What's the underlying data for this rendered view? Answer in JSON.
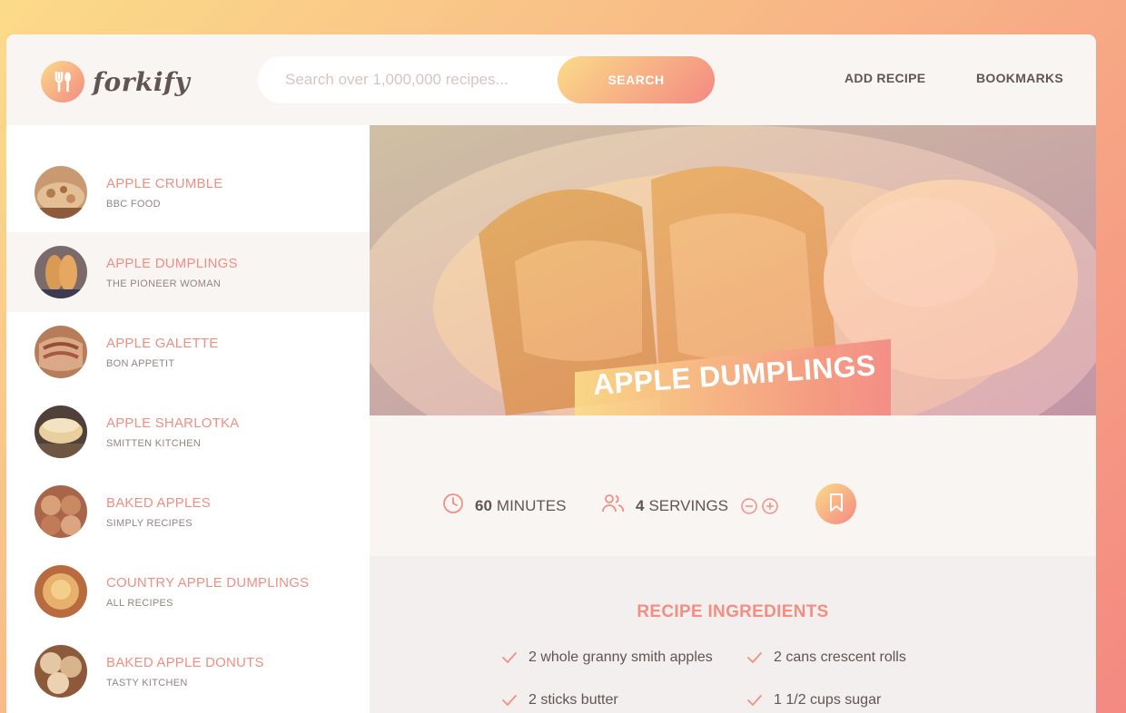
{
  "app": {
    "name": "forkify"
  },
  "header": {
    "search_placeholder": "Search over 1,000,000 recipes...",
    "search_button": "SEARCH",
    "nav": {
      "add_recipe": "ADD RECIPE",
      "bookmarks": "BOOKMARKS"
    }
  },
  "results": [
    {
      "title": "APPLE CRUMBLE",
      "publisher": "BBC FOOD",
      "active": false
    },
    {
      "title": "APPLE DUMPLINGS",
      "publisher": "THE PIONEER WOMAN",
      "active": true
    },
    {
      "title": "APPLE GALETTE",
      "publisher": "BON APPETIT",
      "active": false
    },
    {
      "title": "APPLE SHARLOTKA",
      "publisher": "SMITTEN KITCHEN",
      "active": false
    },
    {
      "title": "BAKED APPLES",
      "publisher": "SIMPLY RECIPES",
      "active": false
    },
    {
      "title": "COUNTRY APPLE DUMPLINGS",
      "publisher": "ALL RECIPES",
      "active": false
    },
    {
      "title": "BAKED APPLE DONUTS",
      "publisher": "TASTY KITCHEN",
      "active": false
    }
  ],
  "recipe": {
    "title": "APPLE DUMPLINGS",
    "minutes": "60",
    "minutes_label": "MINUTES",
    "servings": "4",
    "servings_label": "SERVINGS",
    "ingredients_heading": "RECIPE INGREDIENTS",
    "ingredients": [
      "2 whole granny smith apples",
      "2 cans crescent rolls",
      "2 sticks butter",
      "1 1/2 cups sugar"
    ]
  },
  "colors": {
    "accent": "#f38e82",
    "gradient_start": "#fbdb89",
    "gradient_end": "#f48982",
    "text": "#615551"
  },
  "icons": [
    "fork-spoon-icon",
    "clock-icon",
    "users-icon",
    "minus-circle-icon",
    "plus-circle-icon",
    "bookmark-icon",
    "check-icon"
  ]
}
